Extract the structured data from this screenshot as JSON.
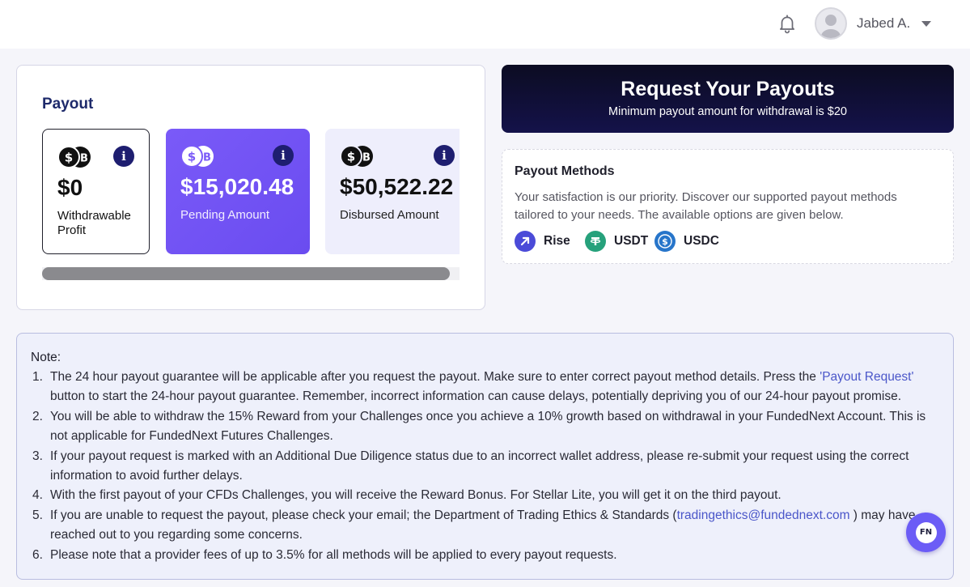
{
  "header": {
    "user_name": "Jabed A.",
    "icons": {
      "notification": "bell-icon",
      "avatar": "user-avatar",
      "dropdown": "caret-down-icon"
    }
  },
  "payout": {
    "title": "Payout",
    "stats": [
      {
        "icon": "coins-icon",
        "value": "$0",
        "label": "Withdrawable Profit"
      },
      {
        "icon": "coins-icon",
        "value": "$15,020.48",
        "label": "Pending Amount"
      },
      {
        "icon": "coins-icon",
        "value": "$50,522.22",
        "label": "Disbursed Amount"
      }
    ],
    "info_icon": "i"
  },
  "request": {
    "title": "Request Your Payouts",
    "subtitle": "Minimum payout amount for withdrawal is $20"
  },
  "methods": {
    "title": "Payout Methods",
    "description": "Your satisfaction is our priority. Discover our supported payout methods tailored to your needs. The available options are given below.",
    "items": [
      {
        "label": "Rise",
        "icon": "rise-icon",
        "color": "#4b4bd8"
      },
      {
        "label": "USDT",
        "icon": "tether-icon",
        "color": "#26a17b"
      },
      {
        "label": "USDC",
        "icon": "usdc-icon",
        "color": "#2775ca"
      }
    ]
  },
  "notes": {
    "title": "Note:",
    "items": [
      {
        "num": "1.",
        "pre": "The 24 hour payout guarantee will be applicable after you request the payout. Make sure to enter correct payout method details. Press the ",
        "link": "'Payout Request'",
        "post": " button to start the 24-hour payout guarantee. Remember, incorrect information can cause delays, potentially depriving you of our 24-hour payout promise."
      },
      {
        "num": "2.",
        "text": "You will be able to withdraw the 15% Reward from your Challenges once you achieve a 10% growth based on withdrawal in your FundedNext Account. This is not applicable for FundedNext Futures Challenges."
      },
      {
        "num": "3.",
        "text": "If your payout request is marked with an Additional Due Diligence status due to an incorrect wallet address, please re-submit your request using the correct information to avoid further delays."
      },
      {
        "num": "4.",
        "text": "With the first payout of your CFDs Challenges, you will receive the Reward Bonus. For Stellar Lite, you will get it on the third payout."
      },
      {
        "num": "5.",
        "pre": "If you are unable to request the payout, please check your email; the Department of Trading Ethics & Standards (",
        "link": "tradingethics@fundednext.com",
        "post": " ) may have reached out to you regarding some concerns."
      },
      {
        "num": "6.",
        "text": "Please note that a provider fees of up to 3.5% for all methods will be applied to every payout requests."
      }
    ]
  },
  "chat": {
    "label": "FN",
    "icon": "chat-widget-icon"
  },
  "colors": {
    "accent": "#6b5cf6",
    "navy": "#1e2a6b",
    "dark_banner": "#0c0c22"
  }
}
